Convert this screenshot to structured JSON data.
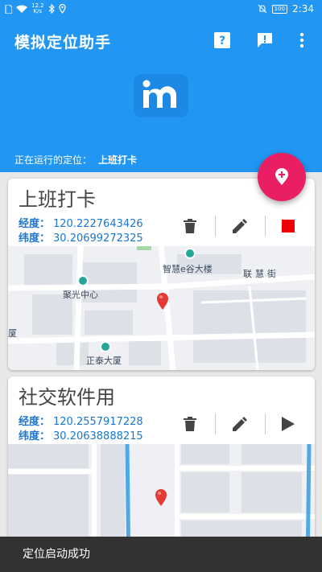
{
  "status_bar": {
    "net_speed_value": "12.2",
    "net_speed_unit": "K/s",
    "battery": "100",
    "time": "2:34"
  },
  "app_bar": {
    "title": "模拟定位助手",
    "help_icon": "help-icon",
    "feedback_icon": "feedback-icon",
    "menu_icon": "more-vert-icon"
  },
  "header": {
    "logo_icon": "app-logo-icon",
    "running_label": "正在运行的定位：",
    "running_value": "上班打卡"
  },
  "fab": {
    "icon": "add-location-icon",
    "color": "#e91e63"
  },
  "colors": {
    "primary": "#2196f3",
    "coord_text": "#1976d2",
    "stop": "#f00000"
  },
  "cards": [
    {
      "title": "上班打卡",
      "longitude_label": "经度：",
      "longitude": "120.2227643426",
      "latitude_label": "纬度：",
      "latitude": "30.20699272325",
      "actions": [
        "delete-icon",
        "edit-icon",
        "stop-icon"
      ],
      "map": {
        "labels": [
          "智慧e谷大楼",
          "联慧街",
          "聚光中心",
          "正泰大厦",
          "厦"
        ]
      }
    },
    {
      "title": "社交软件用",
      "longitude_label": "经度：",
      "longitude": "120.2557917228",
      "latitude_label": "纬度：",
      "latitude": "30.20638888215",
      "actions": [
        "delete-icon",
        "edit-icon",
        "play-icon"
      ]
    }
  ],
  "toast": {
    "message": "定位启动成功"
  }
}
